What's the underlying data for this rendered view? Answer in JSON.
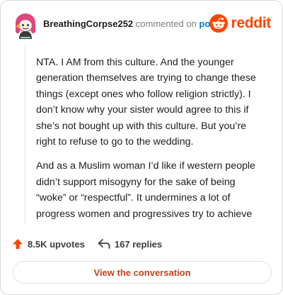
{
  "header": {
    "username": "BreathingCorpse252",
    "action_text": "commented on",
    "post_link_text": "post",
    "brand": "reddit"
  },
  "comment": {
    "paragraphs": [
      "NTA. I AM from this culture. And the younger generation themselves are trying to change these things (except ones who follow religion strictly). I don’t know why your sister would agree to this if she’s not bought up with this culture. But you’re right to refuse to go to the wedding.",
      "And as a Muslim woman I’d like if western people didn’t support misogyny for the sake of being “woke” or “respectful”. It undermines a lot of progress women and progressives try to achieve"
    ]
  },
  "footer": {
    "upvotes_label": "8.5K upvotes",
    "replies_label": "167 replies",
    "cta_label": "View the conversation"
  },
  "colors": {
    "accent": "#ff4500",
    "link": "#0079d3",
    "cta_text": "#c0421b"
  },
  "icons": {
    "avatar": "user-avatar",
    "logo": "reddit-logo-icon",
    "upvote": "upvote-arrow-icon",
    "reply": "reply-arrow-icon"
  }
}
